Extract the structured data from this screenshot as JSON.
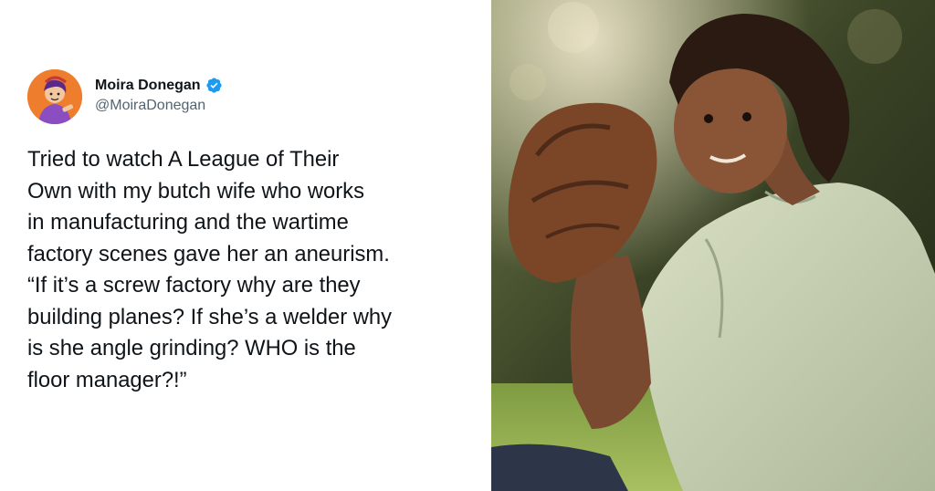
{
  "tweet": {
    "author_name": "Moira Donegan",
    "author_handle": "@MoiraDonegan",
    "text_lines": [
      "Tried to watch A League of Their",
      "Own with my butch wife who works",
      "in manufacturing and the wartime",
      "factory scenes gave her an aneurism.",
      "“If it’s a screw factory why are they",
      "building planes? If she’s a welder why",
      "is she angle grinding? WHO is the",
      "floor manager?!”"
    ]
  },
  "colors": {
    "text": "#0f1419",
    "handle": "#536471",
    "verified_badge": "#1d9bf0",
    "avatar_background": "#ef7d2e"
  },
  "icons": {
    "verified": "verified-badge-icon"
  }
}
